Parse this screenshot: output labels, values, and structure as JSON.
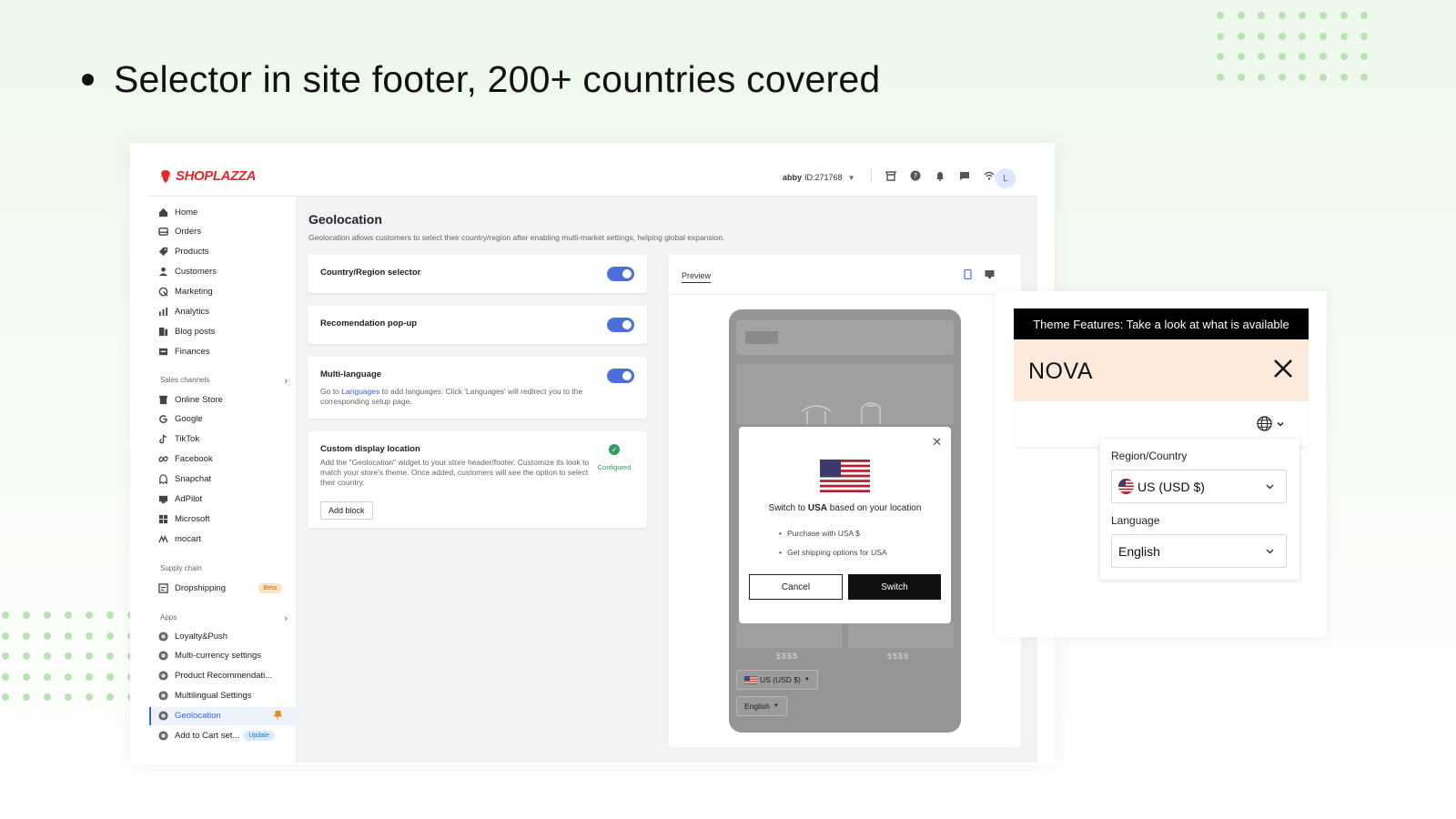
{
  "headline": "Selector in site footer, 200+ countries covered",
  "brand": {
    "name": "SHOPLAZZA",
    "color": "#e02b2b"
  },
  "topbar": {
    "account_user": "abby",
    "account_id": "ID:271768",
    "avatar_letter": "L"
  },
  "sidebar": {
    "main_items": [
      {
        "label": "Home",
        "icon": "home-icon"
      },
      {
        "label": "Orders",
        "icon": "orders-icon"
      },
      {
        "label": "Products",
        "icon": "tag-icon"
      },
      {
        "label": "Customers",
        "icon": "user-icon"
      },
      {
        "label": "Marketing",
        "icon": "marketing-icon"
      },
      {
        "label": "Analytics",
        "icon": "chart-icon"
      },
      {
        "label": "Blog posts",
        "icon": "blog-icon"
      },
      {
        "label": "Finances",
        "icon": "finance-icon"
      }
    ],
    "sales_channels_label": "Sales channels",
    "sales_channels": [
      {
        "label": "Online Store",
        "icon": "store-icon"
      },
      {
        "label": "Google",
        "icon": "google-icon"
      },
      {
        "label": "TikTok",
        "icon": "tiktok-icon"
      },
      {
        "label": "Facebook",
        "icon": "meta-icon"
      },
      {
        "label": "Snapchat",
        "icon": "ghost-icon"
      },
      {
        "label": "AdPilot",
        "icon": "monitor-icon"
      },
      {
        "label": "Microsoft",
        "icon": "grid-icon"
      },
      {
        "label": "mocart",
        "icon": "mocart-icon"
      }
    ],
    "supply_chain_label": "Supply chain",
    "dropshipping": {
      "label": "Dropshipping",
      "badge": "Beta"
    },
    "apps_label": "Apps",
    "apps": [
      {
        "label": "Loyalty&Push"
      },
      {
        "label": "Multi-currency settings"
      },
      {
        "label": "Product Recommendati..."
      },
      {
        "label": "Multilingual Settings"
      },
      {
        "label": "Geolocation",
        "active": true
      },
      {
        "label": "Add to Cart set...",
        "badge": "Update"
      }
    ]
  },
  "page": {
    "title": "Geolocation",
    "description": "Geolocation allows customers to select their country/region after enabling multi-market settings, helping global expansion."
  },
  "settings": {
    "country_selector": {
      "title": "Country/Region selector",
      "enabled": true
    },
    "recommendation_popup": {
      "title": "Recomendation pop-up",
      "enabled": true
    },
    "multi_language": {
      "title": "Multi-language",
      "enabled": true,
      "desc_before": "Go to ",
      "desc_link": "Languages",
      "desc_after": " to add languages. Click 'Languages' will redirect you to the corresponding setup page."
    },
    "custom_location": {
      "title": "Custom display location",
      "desc": "Add the \"Geolocation\" widget to your store header/footer. Customize its look to match your store's theme. Once added, customers will see the option to select their country.",
      "status": "Configured",
      "button": "Add block"
    }
  },
  "preview": {
    "label": "Preview",
    "price_placeholder": "$$$$",
    "popup": {
      "message_before": "Switch to ",
      "message_country": "USA",
      "message_after": " based on your location",
      "bullets": [
        "Purchase with USA $",
        "Get shipping options for USA"
      ],
      "cancel": "Cancel",
      "switch": "Switch"
    },
    "currency_select": "US (USD $)",
    "language_select": "English"
  },
  "zoom_panel": {
    "theme_bar": "Theme Features: Take a look at what is available",
    "theme_name": "NOVA",
    "region_label": "Region/Country",
    "region_value": "US (USD $)",
    "language_label": "Language",
    "language_value": "English"
  },
  "colors": {
    "accent": "#4d6fdc",
    "success": "#2e9e5c",
    "dots": "#b9e3b3"
  }
}
